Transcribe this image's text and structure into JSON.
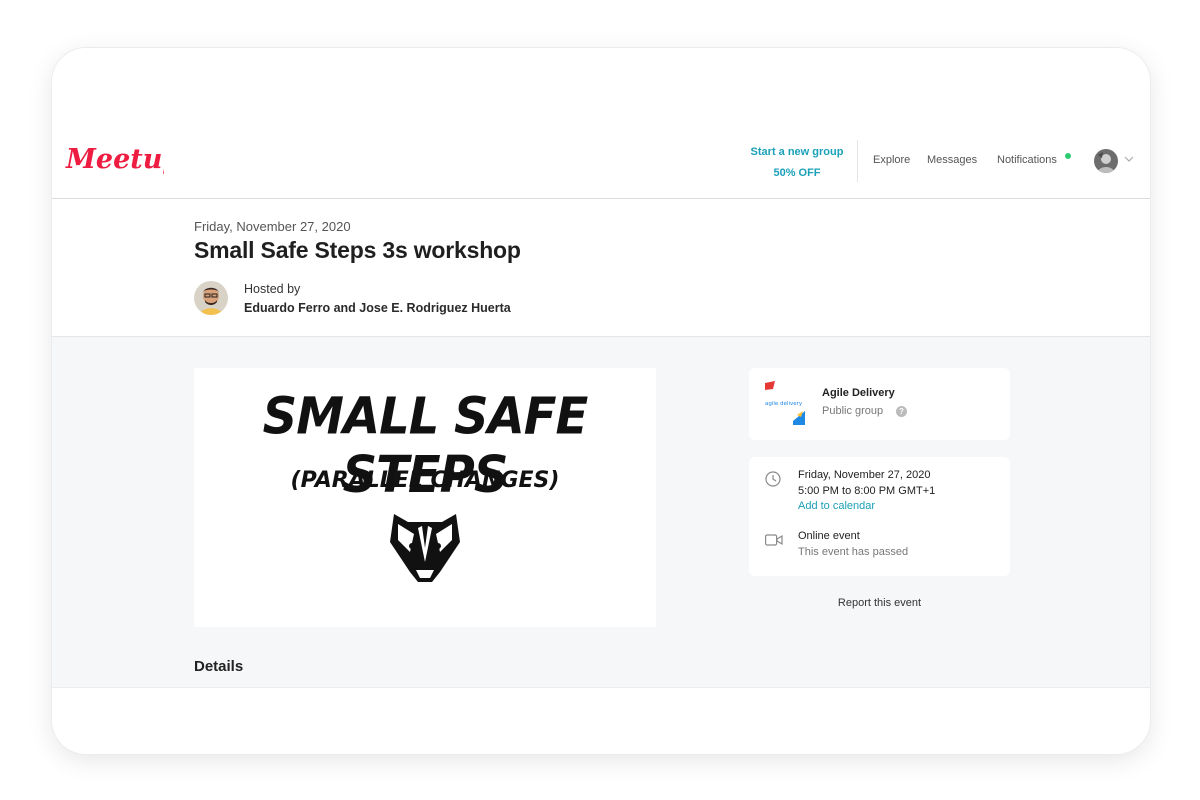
{
  "header": {
    "logo_text": "Meetup",
    "cta_line1": "Start a new group",
    "cta_line2": "50% OFF",
    "nav": [
      "Explore",
      "Messages",
      "Notifications"
    ],
    "brand_color": "#ed1c40",
    "accent_color": "#1aa1b8",
    "notification_dot_color": "#2ecc71"
  },
  "event": {
    "date": "Friday, November 27, 2020",
    "title": "Small Safe Steps 3s workshop",
    "hosted_by_label": "Hosted by",
    "hosts": "Eduardo Ferro and Jose E. Rodriguez Huerta",
    "image_title": "SMALL SAFE STEPS",
    "image_subtitle": "(PARALLEL CHANGES)",
    "details_label": "Details"
  },
  "group": {
    "name": "Agile Delivery",
    "type": "Public group",
    "logo_text": "agile delivery",
    "help_icon_glyph": "?"
  },
  "schedule": {
    "date": "Friday, November 27, 2020",
    "time": "5:00 PM to 8:00 PM GMT+1",
    "add_to_calendar": "Add to calendar",
    "location": "Online event",
    "status": "This event has passed"
  },
  "report_label": "Report this event"
}
